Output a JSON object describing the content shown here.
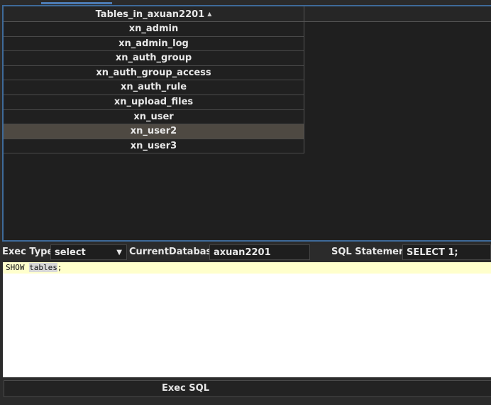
{
  "results": {
    "column_header": "Tables_in_axuan2201",
    "sort_indicator": "▲",
    "rows": [
      "xn_admin",
      "xn_admin_log",
      "xn_auth_group",
      "xn_auth_group_access",
      "xn_auth_rule",
      "xn_upload_files",
      "xn_user",
      "xn_user2",
      "xn_user3"
    ],
    "selected_row": "xn_user2"
  },
  "controls": {
    "exec_type_label": "Exec Type",
    "exec_type_value": "select",
    "current_db_label": "CurrentDatabase",
    "current_db_value": "axuan2201",
    "sql_statement_label": "SQL Statement",
    "sql_statement_value": "SELECT 1;"
  },
  "editor": {
    "keyword": "SHOW",
    "object": "tables",
    "terminator": ";"
  },
  "exec_button_label": "Exec SQL",
  "colors": {
    "accent": "#3e6a99",
    "selected_row": "#4e4942",
    "editor_line_highlight": "#ffffcc"
  }
}
